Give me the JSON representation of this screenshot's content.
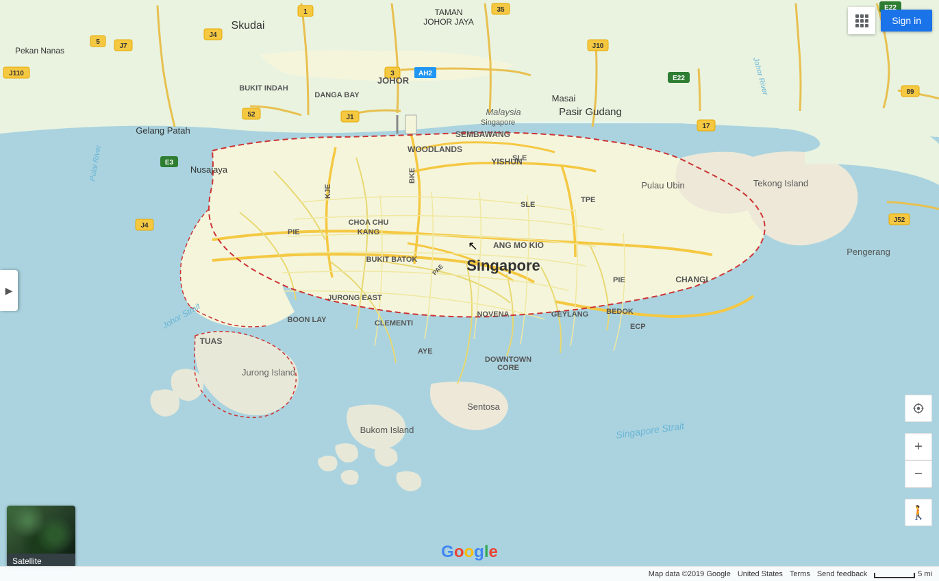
{
  "header": {
    "sign_in_label": "Sign in"
  },
  "map": {
    "region": "Singapore",
    "zoom_in_label": "+",
    "zoom_out_label": "−"
  },
  "satellite_toggle": {
    "label": "Satellite"
  },
  "bottom_bar": {
    "map_data": "Map data ©2019 Google",
    "region": "United States",
    "terms": "Terms",
    "send_feedback": "Send feedback",
    "scale": "5 mi"
  },
  "left_panel_toggle": "▶",
  "places": {
    "singapore": "Singapore",
    "skudai": "Skudai",
    "johor": "JOHOR",
    "taman_johor_jaya": "TAMAN JOHOR JAYA",
    "masai": "Masai",
    "pasir_gudang": "Pasir Gudang",
    "nusajaya": "Nusajaya",
    "gelang_patah": "Gelang Patah",
    "pekan_nanas": "Pekan Nanas",
    "bukit_indah": "BUKIT INDAH",
    "danga_bay": "DANGA BAY",
    "woodlands": "WOODLANDS",
    "sembawang": "SEMBAWANG",
    "yishun": "YISHUN",
    "pulau_ubin": "Pulau Ubin",
    "tekong_island": "Tekong Island",
    "choa_chu_kang": "CHOA CHU KANG",
    "ang_mo_kio": "ANG MO KIO",
    "bukit_batok": "BUKIT BATOK",
    "changi": "CHANGI",
    "jurong_east": "JURONG EAST",
    "novena": "NOVENA",
    "geylang": "GEYLANG",
    "bedok": "BEDOK",
    "boon_lay": "BOON LAY",
    "clementi": "CLEMENTI",
    "downtown_core": "DOWNTOWN CORE",
    "tuas": "TUAS",
    "jurong_island": "Jurong Island",
    "sentosa": "Sentosa",
    "bukom_island": "Bukom Island",
    "pengerang": "Pengerang",
    "johor_strait": "Johor Strait",
    "singapore_strait": "Singapore Strait",
    "malaysia": "Malaysia"
  },
  "highway_labels": {
    "e22": "E22",
    "j7": "J7",
    "j4_top": "J4",
    "ah2": "AH2",
    "j10": "J10",
    "e22_right": "E22",
    "j110": "J110",
    "5": "5",
    "1_top": "1",
    "3": "3",
    "35": "35",
    "17": "17",
    "52": "52",
    "j1": "J1",
    "j52": "J52",
    "89": "89",
    "e3": "E3",
    "j4_left": "J4",
    "sle": "SLE",
    "tpe": "TPE",
    "bke": "BKE",
    "sle2": "SLE",
    "kje": "KJE",
    "pie": "PIE",
    "pie2": "PIE",
    "aye": "AYE",
    "ecp": "ECP"
  }
}
